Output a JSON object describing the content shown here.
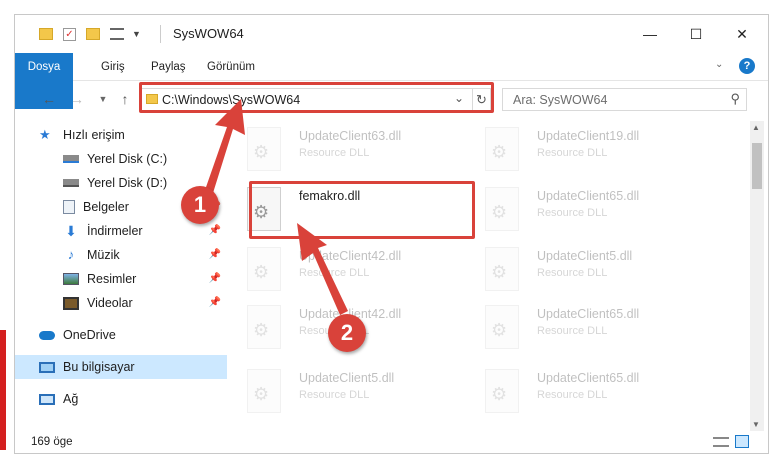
{
  "window": {
    "title": "SysWOW64",
    "controls": {
      "minimize": "—",
      "maximize": "☐",
      "close": "✕"
    }
  },
  "ribbon": {
    "tabs": [
      "Dosya",
      "Giriş",
      "Paylaş",
      "Görünüm"
    ],
    "help": "?"
  },
  "navigation": {
    "address": "C:\\Windows\\SysWOW64",
    "search_placeholder": "Ara: SysWOW64"
  },
  "sidebar": {
    "items": [
      {
        "label": "Hızlı erişim",
        "icon": "star-icon"
      },
      {
        "label": "Yerel Disk (C:)",
        "icon": "drive-icon"
      },
      {
        "label": "Yerel Disk (D:)",
        "icon": "drive-icon"
      },
      {
        "label": "Belgeler",
        "icon": "documents-icon"
      },
      {
        "label": "İndirmeler",
        "icon": "download-icon"
      },
      {
        "label": "Müzik",
        "icon": "music-icon"
      },
      {
        "label": "Resimler",
        "icon": "pictures-icon"
      },
      {
        "label": "Videolar",
        "icon": "videos-icon"
      },
      {
        "label": "OneDrive",
        "icon": "cloud-icon"
      },
      {
        "label": "Bu bilgisayar",
        "icon": "computer-icon"
      },
      {
        "label": "Ağ",
        "icon": "network-icon"
      }
    ]
  },
  "files": [
    {
      "name": "UpdateClient63.dll",
      "type": "Resource DLL"
    },
    {
      "name": "UpdateClient19.dll",
      "type": "Resource DLL"
    },
    {
      "name": "femakro.dll",
      "type": ""
    },
    {
      "name": "UpdateClient65.dll",
      "type": "Resource DLL"
    },
    {
      "name": "UpdateClient42.dll",
      "type": "Resource DLL"
    },
    {
      "name": "UpdateClient5.dll",
      "type": "Resource DLL"
    },
    {
      "name": "UpdateClient42.dll",
      "type": "Resource DLL"
    },
    {
      "name": "UpdateClient65.dll",
      "type": "Resource DLL"
    },
    {
      "name": "UpdateClient5.dll",
      "type": "Resource DLL"
    },
    {
      "name": "UpdateClient65.dll",
      "type": "Resource DLL"
    }
  ],
  "status": {
    "count": "169 öge"
  },
  "annotations": {
    "step1": "1",
    "step2": "2"
  },
  "colors": {
    "accent": "#1979ca",
    "highlight": "#d9423a",
    "selection": "#cce8ff"
  }
}
